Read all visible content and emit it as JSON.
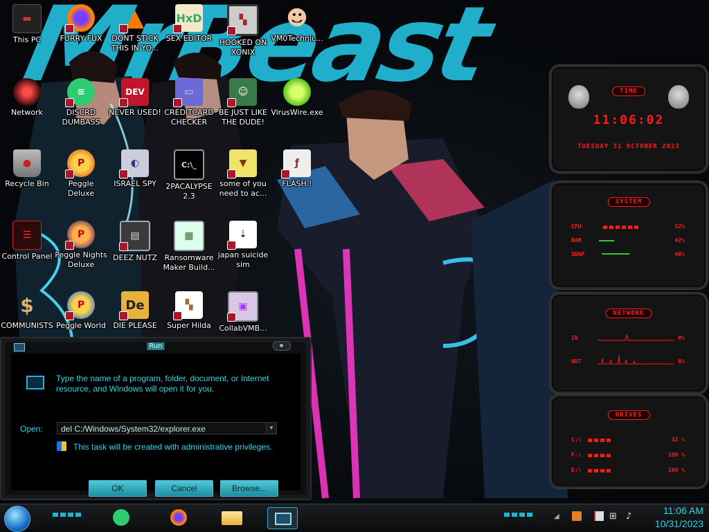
{
  "desktop_icons": [
    {
      "label": "This PC",
      "icon": "computer-icon"
    },
    {
      "label": "FURRY FUX",
      "icon": "firefox-icon"
    },
    {
      "label": "DONT STICK THIS IN YO...",
      "icon": "vlc-icon"
    },
    {
      "label": "SEX EDITOR",
      "icon": "hex-editor-icon"
    },
    {
      "label": "HOOKED ON XONIX",
      "icon": "xonix-icon"
    },
    {
      "label": "VM0Technic...",
      "icon": "doctor-icon"
    },
    {
      "label": "Network",
      "icon": "network-icon"
    },
    {
      "label": "DISCRD DUMBASS",
      "icon": "chat-icon"
    },
    {
      "label": "NEVER USED!",
      "icon": "devcpp-icon"
    },
    {
      "label": "CREDITCARD CHECKER",
      "icon": "creditcard-icon"
    },
    {
      "label": "BE JUST LIKE THE DUDE!",
      "icon": "santa-icon"
    },
    {
      "label": "VirusWire.exe",
      "icon": "lime-icon"
    },
    {
      "label": "Recycle Bin",
      "icon": "recycle-bin-icon"
    },
    {
      "label": "Peggle Deluxe",
      "icon": "peggle-icon"
    },
    {
      "label": "ISRAEL SPY",
      "icon": "spy-icon"
    },
    {
      "label": "2PACALYPSE 2.3",
      "icon": "cmd-icon"
    },
    {
      "label": "some of you need to ac...",
      "icon": "beaver-icon"
    },
    {
      "label": "FLASH !",
      "icon": "flash-icon"
    },
    {
      "label": "Control Panel",
      "icon": "control-panel-icon"
    },
    {
      "label": "Peggle Nights Deluxe",
      "icon": "peggle-nights-icon"
    },
    {
      "label": "DEEZ NUTZ",
      "icon": "windows-stack-icon"
    },
    {
      "label": "Ransomware Maker Build...",
      "icon": "ransomware-icon"
    },
    {
      "label": "japan suicide sim",
      "icon": "document-icon"
    },
    {
      "label": "COMMUNISTS",
      "icon": "money-bag-icon"
    },
    {
      "label": "Peggle World",
      "icon": "peggle-world-icon"
    },
    {
      "label": "DIE PLEASE",
      "icon": "de-icon"
    },
    {
      "label": "Super Hilda",
      "icon": "pixel-dog-icon"
    },
    {
      "label": "CollabVMB...",
      "icon": "monitor-icon"
    }
  ],
  "wallpaper": {
    "title_text": "MrBeast"
  },
  "gadgets": {
    "time": {
      "title": "TIME",
      "clock": "11:06:02",
      "date": "TUESDAY 31 OCTOBER 2023"
    },
    "system": {
      "title": "SYSTEM",
      "rows": [
        {
          "label": "CPU",
          "value": "52%",
          "level": 0.52
        },
        {
          "label": "RAM",
          "value": "42%",
          "level": 0.42
        },
        {
          "label": "SWAP",
          "value": "40%",
          "level": 0.4
        }
      ]
    },
    "network": {
      "title": "NETWORK",
      "rows": [
        {
          "label": "IN",
          "value": "0%"
        },
        {
          "label": "OUT",
          "value": "0%"
        }
      ]
    },
    "drives": {
      "title": "DRIVES",
      "rows": [
        {
          "label": "C:\\",
          "value": "32 %",
          "level": 0.32
        },
        {
          "label": "F:\\",
          "value": "100 %",
          "level": 1.0
        },
        {
          "label": "E:\\",
          "value": "100 %",
          "level": 1.0
        }
      ]
    }
  },
  "run_dialog": {
    "title": "Run",
    "instructions": "Type the name of a program, folder, document, or Internet resource, and Windows will open it for you.",
    "open_label": "Open:",
    "open_value": "del C:/Windows/System32/explorer.exe",
    "admin_note": "This task will be created with administrative privileges.",
    "ok": "OK",
    "cancel": "Cancel",
    "browse": "Browse..."
  },
  "taskbar": {
    "apps": [
      {
        "icon": "chat-app-icon",
        "active": false
      },
      {
        "icon": "firefox-icon",
        "active": false
      },
      {
        "icon": "file-explorer-icon",
        "active": false
      },
      {
        "icon": "run-window-icon",
        "active": true
      }
    ],
    "time": "11:06 AM",
    "date": "10/31/2023"
  },
  "colors": {
    "accent": "#22b7d6",
    "gadget_red": "#ff1a1a"
  }
}
